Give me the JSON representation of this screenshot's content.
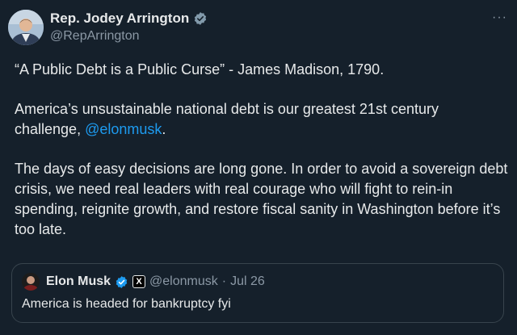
{
  "author": {
    "display_name": "Rep. Jodey Arrington",
    "handle": "@RepArrington",
    "verified_icon": "verified-badge-gray"
  },
  "more_button": {
    "label": "···"
  },
  "tweet": {
    "line1": "“A Public Debt is a Public Curse” - James Madison, 1790.",
    "line2_prefix": "America’s unsustainable national debt is our greatest 21st century challenge, ",
    "line2_mention": "@elonmusk",
    "line2_suffix": ".",
    "line3": "The days of easy decisions are long gone. In order to avoid a sovereign debt crisis, we need real leaders with real courage who will fight to rein-in spending, reignite growth, and restore fiscal sanity in Washington before it’s too late."
  },
  "quoted": {
    "display_name": "Elon Musk",
    "verified_icon": "verified-badge-blue",
    "affiliate_label": "X",
    "handle": "@elonmusk",
    "separator": "·",
    "date": "Jul 26",
    "text": "America is headed for bankruptcy fyi"
  },
  "colors": {
    "background": "#15202b",
    "text": "#e7e9ea",
    "secondary": "#8b98a5",
    "link": "#1d9bf0",
    "border": "#38444d"
  }
}
